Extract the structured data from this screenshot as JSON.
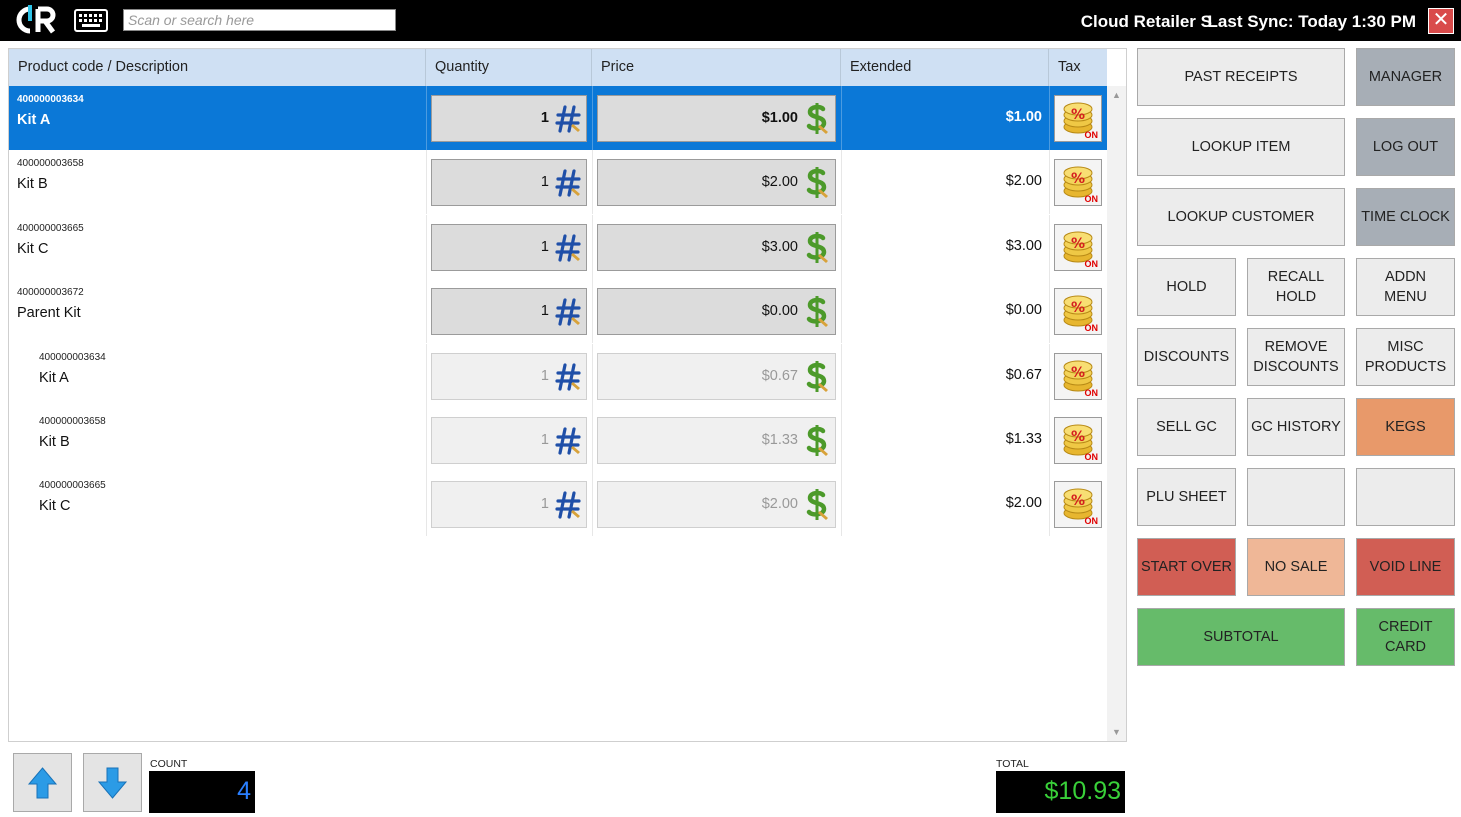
{
  "header": {
    "logo_text": "CR",
    "search_placeholder": "Scan or search here",
    "store_name": "Cloud Retailer S",
    "last_sync": "Last Sync: Today 1:30 PM",
    "close_label": "✕"
  },
  "grid": {
    "columns": [
      "Product code / Description",
      "Quantity",
      "Price",
      "Extended",
      "Tax"
    ],
    "rows": [
      {
        "code": "400000003634",
        "desc": "Kit A",
        "qty": "1",
        "price": "$1.00",
        "extended": "$1.00",
        "tax": "ON"
      },
      {
        "code": "400000003658",
        "desc": "Kit B",
        "qty": "1",
        "price": "$2.00",
        "extended": "$2.00",
        "tax": "ON"
      },
      {
        "code": "400000003665",
        "desc": "Kit C",
        "qty": "1",
        "price": "$3.00",
        "extended": "$3.00",
        "tax": "ON"
      },
      {
        "code": "400000003672",
        "desc": "Parent Kit",
        "qty": "1",
        "price": "$0.00",
        "extended": "$0.00",
        "tax": "ON"
      },
      {
        "code": "400000003634",
        "desc": "Kit A",
        "qty": "1",
        "price": "$0.67",
        "extended": "$0.67",
        "tax": "ON"
      },
      {
        "code": "400000003658",
        "desc": "Kit B",
        "qty": "1",
        "price": "$1.33",
        "extended": "$1.33",
        "tax": "ON"
      },
      {
        "code": "400000003665",
        "desc": "Kit C",
        "qty": "1",
        "price": "$2.00",
        "extended": "$2.00",
        "tax": "ON"
      }
    ]
  },
  "buttons": {
    "past_receipts": "PAST RECEIPTS",
    "manager": "MANAGER",
    "lookup_item": "LOOKUP ITEM",
    "log_out": "LOG OUT",
    "lookup_customer": "LOOKUP CUSTOMER",
    "time_clock": "TIME CLOCK",
    "hold": "HOLD",
    "recall_hold": "RECALL\nHOLD",
    "addn_menu": "ADDN\nMENU",
    "discounts": "DISCOUNTS",
    "remove_discounts": "REMOVE\nDISCOUNTS",
    "misc_products": "MISC\nPRODUCTS",
    "sell_gc": "SELL GC",
    "gc_history": "GC HISTORY",
    "kegs": "KEGS",
    "plu_sheet": "PLU SHEET",
    "start_over": "START OVER",
    "no_sale": "NO SALE",
    "void_line": "VOID LINE",
    "subtotal": "SUBTOTAL",
    "credit_card": "CREDIT\nCARD"
  },
  "footer": {
    "count_label": "COUNT",
    "count_value": "4",
    "total_label": "TOTAL",
    "total_value": "$10.93"
  },
  "colors": {
    "selected_row": "#0b78d7",
    "header_bg": "#cfe0f3",
    "gray_button": "#a7aeb6",
    "kegs": "#e8996a",
    "red_button": "#d15e54",
    "no_sale": "#efb797",
    "green_button": "#66bb6a",
    "total_text": "#39d039",
    "count_text": "#2a7fff"
  }
}
